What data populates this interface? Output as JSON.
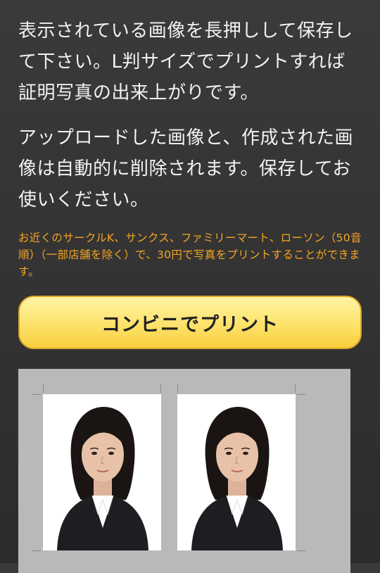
{
  "instructions": {
    "paragraph1": "表示されている画像を長押しして保存して下さい。L判サイズでプリントすれば証明写真の出来上がりです。",
    "paragraph2": "アップロードした画像と、作成された画像は自動的に削除されます。保存してお使いください。",
    "notice": "お近くのサークルK、サンクス、ファミリーマート、ローソン（50音順）（一部店舗を除く）で、30円で写真をプリントすることができます。"
  },
  "print_button": {
    "label": "コンビニでプリント"
  },
  "photo_sheet": {
    "photo_count": 2,
    "colors": {
      "sheet_background": "#b9b9b9",
      "photo_background": "#ffffff",
      "suit": "#1c1e22",
      "hair": "#1a1512",
      "skin": "#e8c2a8"
    }
  },
  "colors": {
    "page_background": "#333333",
    "body_text": "#f2f2f2",
    "notice_text": "#f5a623",
    "button_fill": "#fde26a",
    "button_text": "#222222"
  }
}
